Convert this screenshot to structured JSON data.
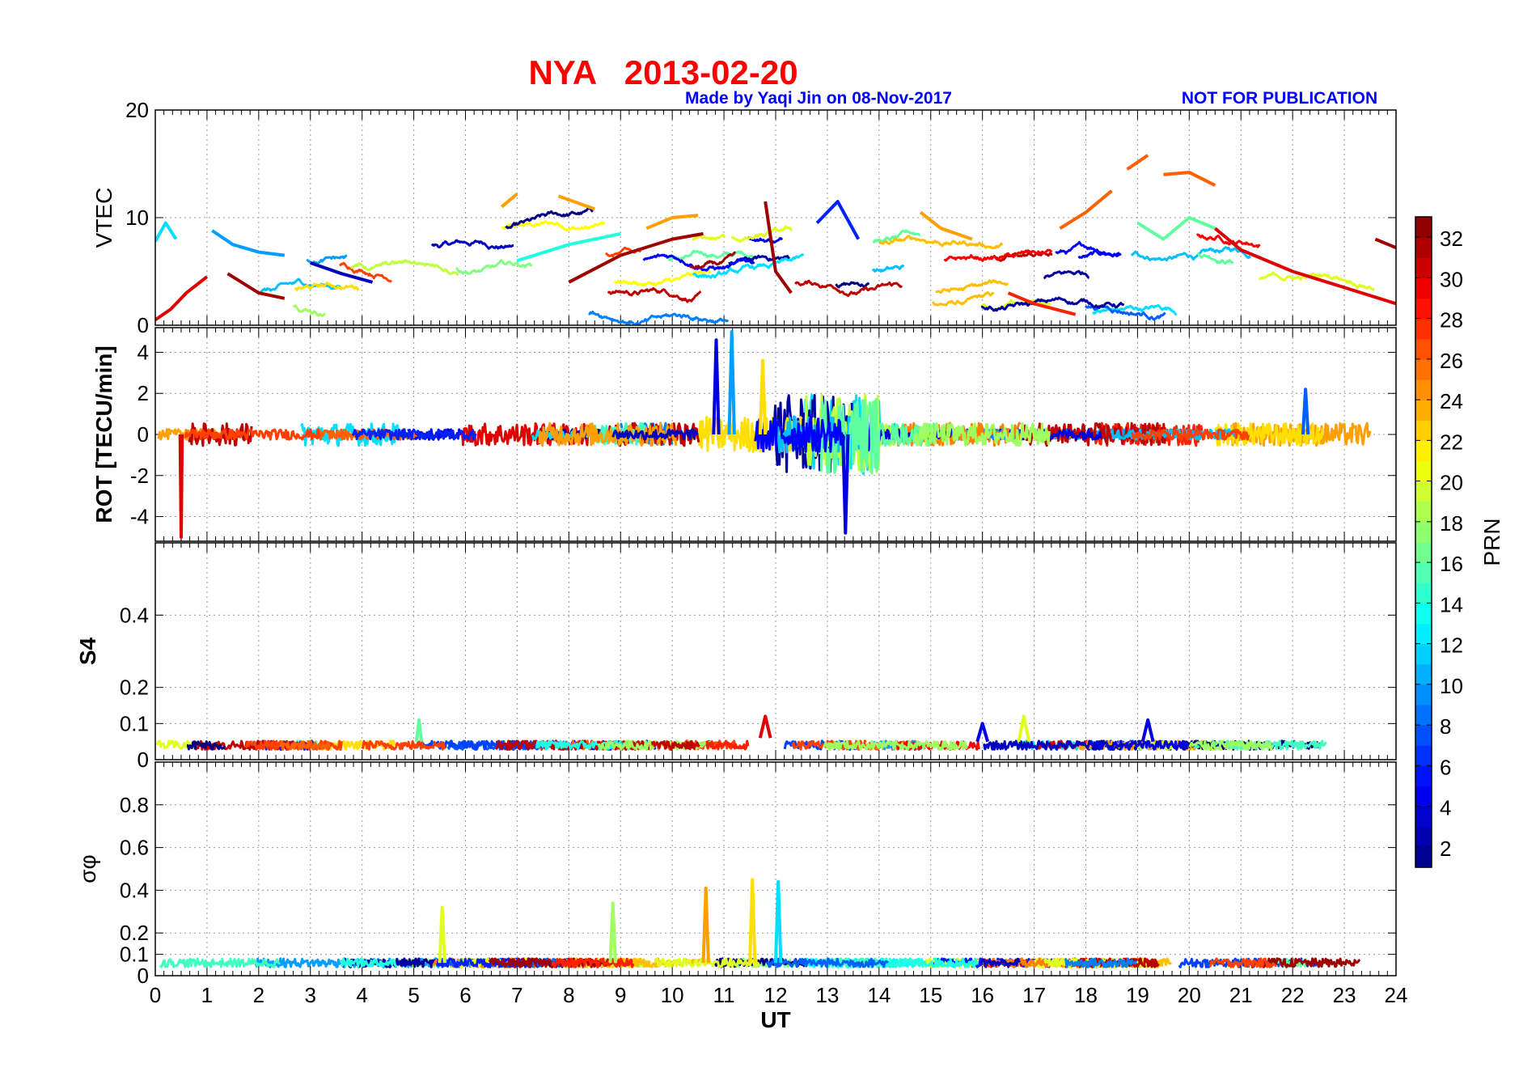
{
  "figure": {
    "title": "NYA   2013-02-20",
    "credit": "Made by Yaqi Jin on 08-Nov-2017",
    "notice": "NOT FOR PUBLICATION",
    "title_color": "#ff0000",
    "credit_color": "#0000ff"
  },
  "chart_data": [
    {
      "id": "vtec",
      "type": "line",
      "ylabel": "VTEC",
      "ylim": [
        0,
        20
      ],
      "yticks": [
        0,
        10,
        20
      ],
      "xlim": [
        0,
        24
      ],
      "grid": true,
      "note": "multiple satellite tracks colored by PRN",
      "series": [
        {
          "prn": 12,
          "x": [
            0.0,
            0.2,
            0.4
          ],
          "y": [
            7.8,
            9.5,
            8.0
          ]
        },
        {
          "prn": 30,
          "x": [
            0.0,
            0.3,
            0.6,
            1.0
          ],
          "y": [
            0.5,
            1.5,
            3.0,
            4.5
          ]
        },
        {
          "prn": 10,
          "x": [
            1.1,
            1.5,
            2.0,
            2.5
          ],
          "y": [
            8.8,
            7.5,
            6.8,
            6.5
          ]
        },
        {
          "prn": 32,
          "x": [
            1.4,
            2.0,
            2.5
          ],
          "y": [
            4.8,
            3.0,
            2.5
          ]
        },
        {
          "prn": 3,
          "x": [
            3.0,
            3.6,
            4.2
          ],
          "y": [
            5.8,
            4.8,
            4.0
          ]
        },
        {
          "prn": 24,
          "x": [
            6.7,
            7.0
          ],
          "y": [
            11.0,
            12.2
          ]
        },
        {
          "prn": 24,
          "x": [
            7.8,
            8.5
          ],
          "y": [
            12.0,
            10.8
          ]
        },
        {
          "prn": 14,
          "x": [
            7.0,
            8.0,
            9.0
          ],
          "y": [
            6.0,
            7.5,
            8.5
          ]
        },
        {
          "prn": 32,
          "x": [
            8.0,
            9.0,
            10.0,
            10.6
          ],
          "y": [
            4.0,
            6.5,
            8.0,
            8.5
          ]
        },
        {
          "prn": 24,
          "x": [
            9.5,
            10.0,
            10.5
          ],
          "y": [
            9.0,
            10.0,
            10.2
          ]
        },
        {
          "prn": 32,
          "x": [
            11.8,
            12.0,
            12.3
          ],
          "y": [
            11.5,
            5.0,
            3.0
          ]
        },
        {
          "prn": 6,
          "x": [
            12.8,
            13.2,
            13.6
          ],
          "y": [
            9.5,
            11.5,
            8.0
          ]
        },
        {
          "prn": 24,
          "x": [
            14.8,
            15.2,
            15.8
          ],
          "y": [
            10.5,
            9.0,
            8.0
          ]
        },
        {
          "prn": 28,
          "x": [
            16.5,
            17.0,
            17.8
          ],
          "y": [
            3.0,
            2.0,
            1.0
          ]
        },
        {
          "prn": 26,
          "x": [
            17.5,
            18.0,
            18.5
          ],
          "y": [
            9.0,
            10.5,
            12.5
          ]
        },
        {
          "prn": 26,
          "x": [
            18.8,
            19.2
          ],
          "y": [
            14.5,
            15.8
          ]
        },
        {
          "prn": 26,
          "x": [
            19.5,
            20.0,
            20.5
          ],
          "y": [
            14.0,
            14.2,
            13.0
          ]
        },
        {
          "prn": 16,
          "x": [
            19.0,
            19.5,
            20.0,
            20.5
          ],
          "y": [
            9.5,
            8.0,
            10.0,
            9.0
          ]
        },
        {
          "prn": 30,
          "x": [
            20.5,
            21.0,
            22.0,
            23.0,
            24.0
          ],
          "y": [
            9.0,
            7.0,
            5.0,
            3.5,
            2.0
          ]
        },
        {
          "prn": 32,
          "x": [
            23.6,
            24.0
          ],
          "y": [
            8.0,
            7.2
          ]
        }
      ]
    },
    {
      "id": "rot",
      "type": "line",
      "ylabel": "ROT [TECU/min]",
      "ylim": [
        -5.2,
        5.2
      ],
      "yticks": [
        -4,
        -2,
        0,
        2,
        4
      ],
      "xlim": [
        0,
        24
      ],
      "grid": true,
      "note": "noisy rate-of-TEC traces around zero, strongest 10.5–14 UT",
      "series": [
        {
          "prn": 30,
          "x": [
            0.48,
            0.5,
            0.52
          ],
          "y": [
            0.0,
            -5.0,
            0.0
          ]
        },
        {
          "prn": 4,
          "x": [
            10.8,
            10.85,
            10.9
          ],
          "y": [
            0.0,
            4.6,
            0.0
          ]
        },
        {
          "prn": 10,
          "x": [
            11.1,
            11.15,
            11.2
          ],
          "y": [
            0.0,
            5.0,
            0.0
          ]
        },
        {
          "prn": 4,
          "x": [
            13.3,
            13.35,
            13.4
          ],
          "y": [
            0.0,
            -4.8,
            0.0
          ]
        },
        {
          "prn": 22,
          "x": [
            11.7,
            11.75,
            11.8
          ],
          "y": [
            0.0,
            3.6,
            0.0
          ]
        },
        {
          "prn": 8,
          "x": [
            22.2,
            22.25,
            22.3
          ],
          "y": [
            0.0,
            2.2,
            0.0
          ]
        }
      ]
    },
    {
      "id": "s4",
      "type": "line",
      "ylabel": "S4",
      "ylim": [
        0,
        0.6
      ],
      "yticks": [
        0,
        0.1,
        0.2,
        0.4
      ],
      "xlim": [
        0,
        24
      ],
      "grid": true,
      "note": "low amplitude scintillation index near 0.03–0.06",
      "series": [
        {
          "prn": 30,
          "x": [
            11.7,
            11.8,
            11.9
          ],
          "y": [
            0.06,
            0.12,
            0.06
          ]
        },
        {
          "prn": 16,
          "x": [
            5.05,
            5.1,
            5.15
          ],
          "y": [
            0.05,
            0.11,
            0.05
          ]
        },
        {
          "prn": 4,
          "x": [
            15.9,
            16.0,
            16.1
          ],
          "y": [
            0.05,
            0.1,
            0.05
          ]
        },
        {
          "prn": 20,
          "x": [
            16.7,
            16.8,
            16.9
          ],
          "y": [
            0.05,
            0.12,
            0.05
          ]
        },
        {
          "prn": 4,
          "x": [
            19.1,
            19.2,
            19.3
          ],
          "y": [
            0.05,
            0.11,
            0.05
          ]
        }
      ]
    },
    {
      "id": "sigphi",
      "type": "line",
      "ylabel": "σφ",
      "ylim": [
        0,
        1.0
      ],
      "yticks": [
        0,
        0.1,
        0.2,
        0.4,
        0.6,
        0.8
      ],
      "xlim": [
        0,
        24
      ],
      "xticks": [
        0,
        1,
        2,
        3,
        4,
        5,
        6,
        7,
        8,
        9,
        10,
        11,
        12,
        13,
        14,
        15,
        16,
        17,
        18,
        19,
        20,
        21,
        22,
        23,
        24
      ],
      "xlabel": "UT",
      "grid": true,
      "note": "phase scintillation index, spikes 9–13 UT",
      "series": [
        {
          "prn": 20,
          "x": [
            5.5,
            5.55,
            5.6
          ],
          "y": [
            0.06,
            0.32,
            0.06
          ]
        },
        {
          "prn": 18,
          "x": [
            8.8,
            8.85,
            8.9
          ],
          "y": [
            0.06,
            0.34,
            0.06
          ]
        },
        {
          "prn": 24,
          "x": [
            10.6,
            10.65,
            10.7
          ],
          "y": [
            0.06,
            0.41,
            0.06
          ]
        },
        {
          "prn": 22,
          "x": [
            11.5,
            11.55,
            11.6
          ],
          "y": [
            0.06,
            0.45,
            0.06
          ]
        },
        {
          "prn": 12,
          "x": [
            12.0,
            12.05,
            12.1
          ],
          "y": [
            0.06,
            0.44,
            0.06
          ]
        }
      ]
    }
  ],
  "colorbar": {
    "label": "PRN",
    "ticks": [
      2,
      4,
      6,
      8,
      10,
      12,
      14,
      16,
      18,
      20,
      22,
      24,
      26,
      28,
      30,
      32
    ],
    "range": [
      1,
      33
    ],
    "colormap": "jet"
  }
}
